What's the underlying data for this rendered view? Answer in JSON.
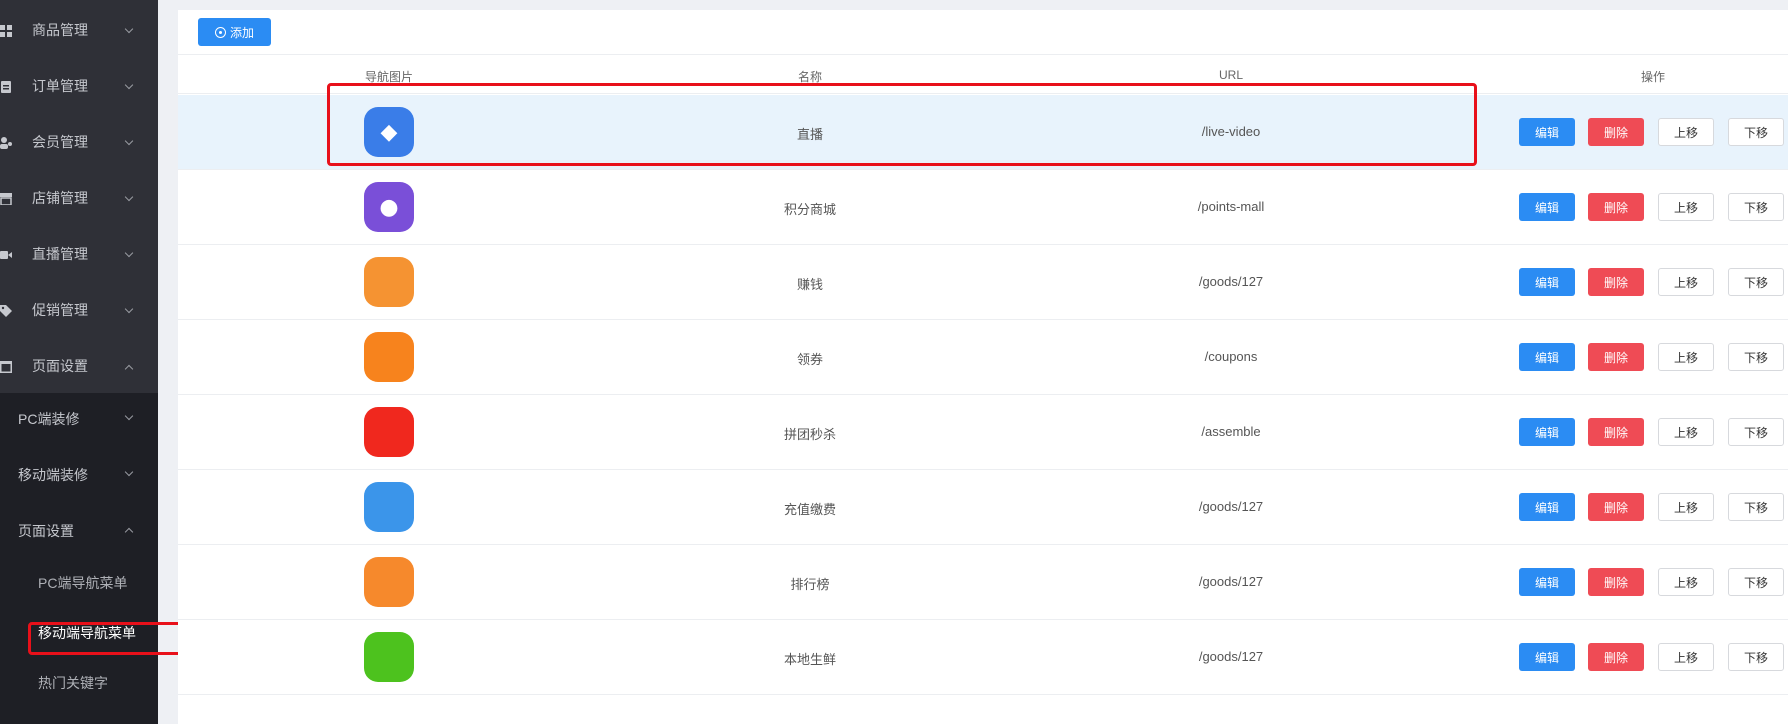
{
  "sidebar": {
    "menus": [
      {
        "label": "商品管理",
        "icon": "grid-icon",
        "expanded": false
      },
      {
        "label": "订单管理",
        "icon": "clipboard-icon",
        "expanded": false
      },
      {
        "label": "会员管理",
        "icon": "users-icon",
        "expanded": false
      },
      {
        "label": "店铺管理",
        "icon": "store-icon",
        "expanded": false
      },
      {
        "label": "直播管理",
        "icon": "video-icon",
        "expanded": false
      },
      {
        "label": "促销管理",
        "icon": "tag-icon",
        "expanded": false
      },
      {
        "label": "页面设置",
        "icon": "page-icon",
        "expanded": true
      }
    ],
    "submenus": [
      {
        "label": "PC端装修",
        "expanded": false
      },
      {
        "label": "移动端装修",
        "expanded": false
      },
      {
        "label": "页面设置",
        "expanded": true
      }
    ],
    "leaves": [
      {
        "label": "PC端导航菜单",
        "active": false
      },
      {
        "label": "移动端导航菜单",
        "active": true
      },
      {
        "label": "热门关键字",
        "active": false
      }
    ]
  },
  "toolbar": {
    "add_label": "添加"
  },
  "table": {
    "headers": {
      "image": "导航图片",
      "name": "名称",
      "url": "URL",
      "ops": "操作"
    },
    "ops": {
      "edit": "编辑",
      "delete": "删除",
      "up": "上移",
      "down": "下移"
    },
    "rows": [
      {
        "name": "直播",
        "url": "/live-video",
        "icon": "diamond-icon",
        "color": "#3a7de8",
        "glyph": "◆",
        "selected": true
      },
      {
        "name": "积分商城",
        "url": "/points-mall",
        "icon": "points-icon",
        "color": "#7a4fd8",
        "glyph": "●",
        "selected": false
      },
      {
        "name": "赚钱",
        "url": "/goods/127",
        "icon": "money-bag-icon",
        "color": "#f59332",
        "glyph": "",
        "selected": false
      },
      {
        "name": "领券",
        "url": "/coupons",
        "icon": "coupon-icon",
        "color": "#f7831d",
        "glyph": "",
        "selected": false
      },
      {
        "name": "拼团秒杀",
        "url": "/assemble",
        "icon": "group-buy-icon",
        "color": "#f0281e",
        "glyph": "",
        "selected": false
      },
      {
        "name": "充值缴费",
        "url": "/goods/127",
        "icon": "recharge-icon",
        "color": "#3b95ea",
        "glyph": "",
        "selected": false
      },
      {
        "name": "排行榜",
        "url": "/goods/127",
        "icon": "ranking-icon",
        "color": "#f6892c",
        "glyph": "",
        "selected": false
      },
      {
        "name": "本地生鲜",
        "url": "/goods/127",
        "icon": "fresh-icon",
        "color": "#4dc21e",
        "glyph": "",
        "selected": false
      }
    ]
  }
}
